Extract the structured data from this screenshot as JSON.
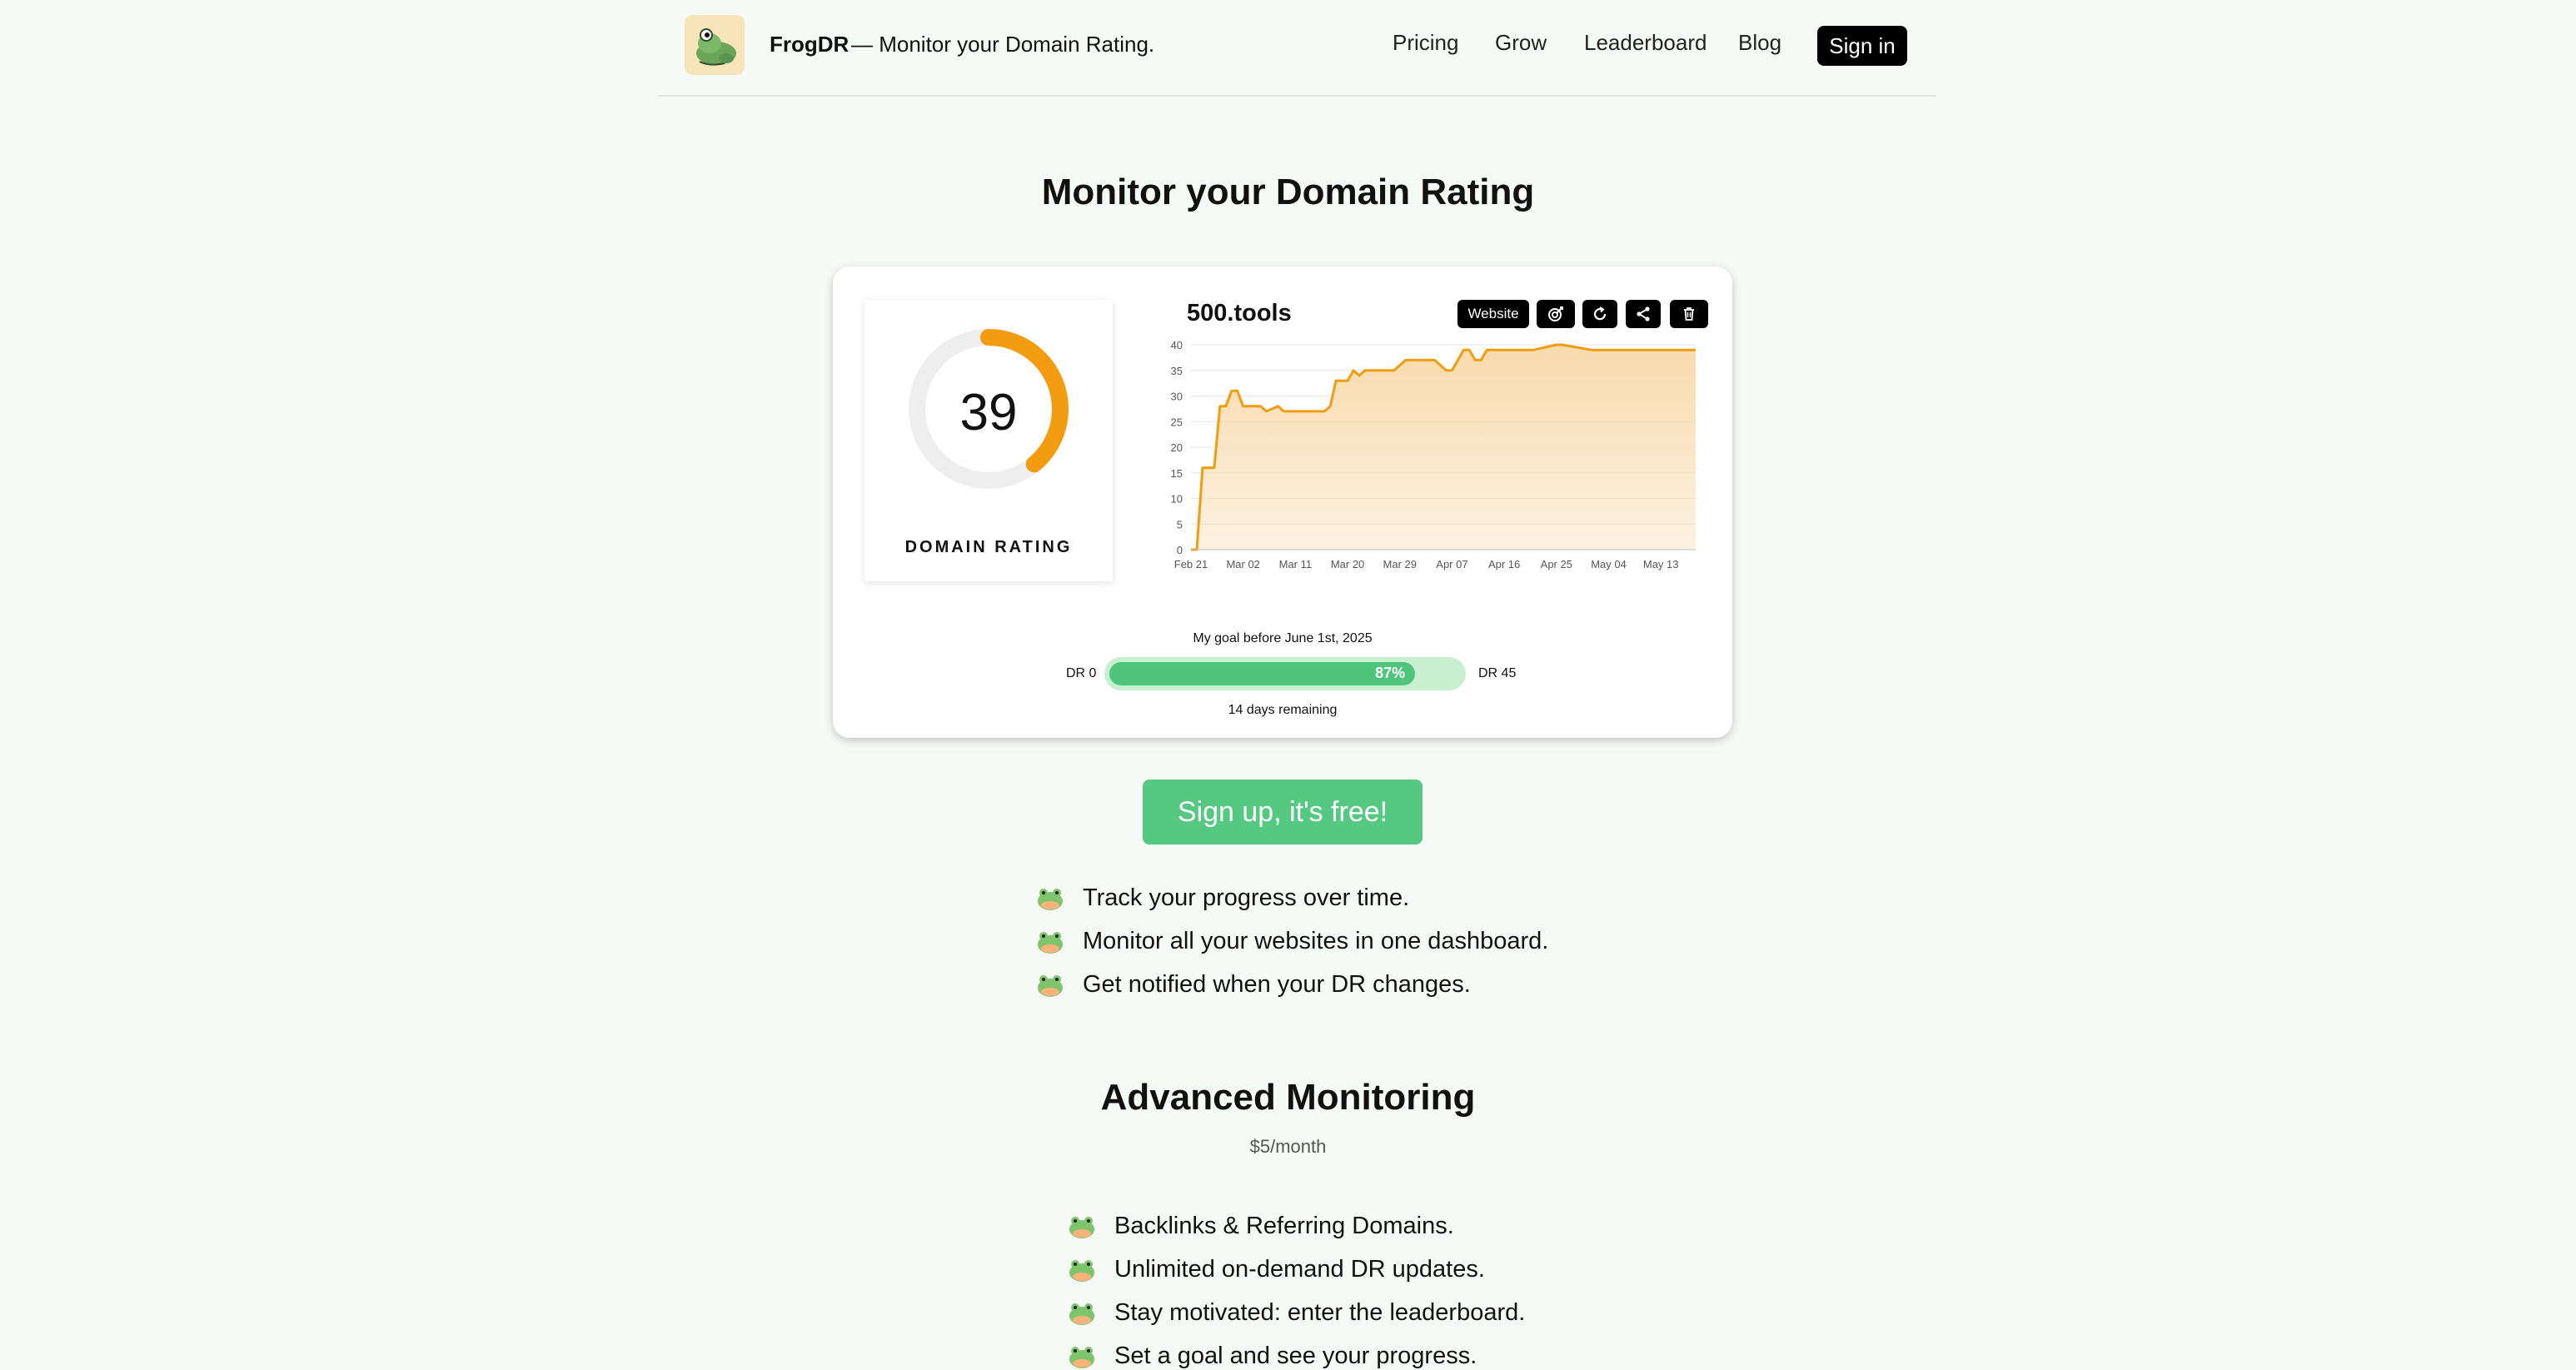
{
  "header": {
    "brand": "FrogDR",
    "tagline": "—  Monitor your Domain Rating.",
    "nav": [
      "Pricing",
      "Grow",
      "Leaderboard",
      "Blog"
    ],
    "signin": "Sign in"
  },
  "hero": {
    "title": "Monitor your Domain Rating"
  },
  "card": {
    "domain_rating": "39",
    "domain_rating_fraction": 0.39,
    "dr_label": "DOMAIN RATING",
    "site": "500.tools",
    "buttons": {
      "website": "Website"
    },
    "icons": [
      "target-icon",
      "refresh-icon",
      "share-icon",
      "trash-icon"
    ],
    "goal": {
      "title": "My goal before June 1st, 2025",
      "start_label": "DR 0",
      "end_label": "DR 45",
      "percent_label": "87%",
      "percent": 87,
      "remaining": "14 days remaining"
    }
  },
  "chart_data": {
    "type": "area",
    "title": "",
    "xlabel": "",
    "ylabel": "",
    "ylim": [
      0,
      40
    ],
    "yticks": [
      "0",
      "5",
      "10",
      "15",
      "20",
      "25",
      "30",
      "35",
      "40"
    ],
    "xticks": [
      "Feb 21",
      "Mar 02",
      "Mar 11",
      "Mar 20",
      "Mar 29",
      "Apr 07",
      "Apr 16",
      "Apr 25",
      "May 04",
      "May 13"
    ],
    "x": [
      "Feb 21",
      "Feb 22",
      "Feb 23",
      "Feb 24",
      "Feb 25",
      "Feb 26",
      "Feb 27",
      "Feb 28",
      "Mar 01",
      "Mar 02",
      "Mar 03",
      "Mar 05",
      "Mar 06",
      "Mar 08",
      "Mar 09",
      "Mar 10",
      "Mar 12",
      "Mar 16",
      "Mar 17",
      "Mar 18",
      "Mar 20",
      "Mar 21",
      "Mar 22",
      "Mar 23",
      "Mar 25",
      "Mar 28",
      "Mar 30",
      "Apr 03",
      "Apr 04",
      "Apr 06",
      "Apr 07",
      "Apr 09",
      "Apr 10",
      "Apr 11",
      "Apr 12",
      "Apr 13",
      "Apr 20",
      "Apr 21",
      "Apr 25",
      "Apr 26",
      "May 01",
      "May 19"
    ],
    "series": [
      {
        "values": [
          0,
          0,
          16,
          16,
          16,
          28,
          28,
          31,
          31,
          28,
          28,
          28,
          27,
          28,
          27,
          27,
          27,
          27,
          28,
          33,
          33,
          35,
          34,
          35,
          35,
          35,
          37,
          37,
          37,
          35,
          35,
          39,
          39,
          37,
          37,
          39,
          39,
          39,
          40,
          40,
          39,
          39
        ]
      }
    ],
    "color": "#f39c12",
    "fill": "#f8d9a8",
    "grid": true
  },
  "cta": "Sign up, it's free!",
  "features": [
    "Track your progress over time.",
    "Monitor all your websites in one dashboard.",
    "Get notified when your DR changes."
  ],
  "advanced": {
    "title": "Advanced Monitoring",
    "price": "$5/month",
    "features": [
      "Backlinks & Referring Domains.",
      "Unlimited on-demand DR updates.",
      "Stay motivated: enter the leaderboard.",
      "Set a goal and see your progress."
    ]
  },
  "colors": {
    "accent": "#55c882",
    "chart": "#f39c12",
    "background": "#f6faf6"
  }
}
